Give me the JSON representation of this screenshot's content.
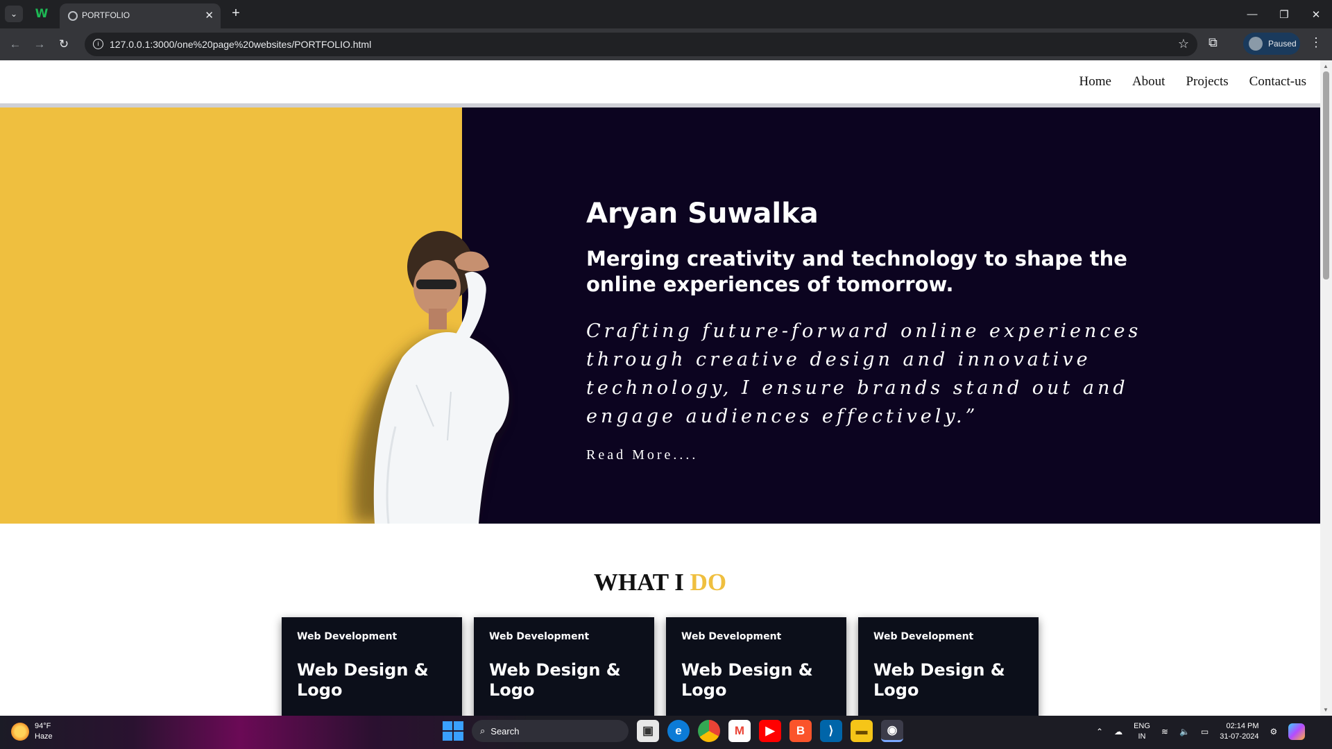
{
  "browser": {
    "tab_title": "PORTFOLIO",
    "url": "127.0.0.1:3000/one%20page%20websites/PORTFOLIO.html",
    "profile_label": "Paused",
    "pinned_tab_letter": "W"
  },
  "site": {
    "nav": [
      "Home",
      "About",
      "Projects",
      "Contact-us"
    ],
    "hero": {
      "name": "Aryan Suwalka",
      "tagline": "Merging creativity and technology to shape the online experiences of tomorrow.",
      "quote": "Crafting future-forward online experiences through creative design and innovative technology, I ensure brands stand out and engage audiences effectively.”",
      "read_more": "Read More...."
    },
    "section": {
      "title_main": "WHAT I",
      "title_accent": "DO"
    },
    "cards": [
      {
        "category": "Web Development",
        "title": "Web Design & Logo"
      },
      {
        "category": "Web Development",
        "title": "Web Design & Logo"
      },
      {
        "category": "Web Development",
        "title": "Web Design & Logo"
      },
      {
        "category": "Web Development",
        "title": "Web Design & Logo"
      }
    ],
    "colors": {
      "accent": "#efbf3f",
      "hero_dark": "#0c0420",
      "card_bg": "#0c0f1a"
    }
  },
  "taskbar": {
    "weather_temp": "94°F",
    "weather_desc": "Haze",
    "search_label": "Search",
    "lang_line1": "ENG",
    "lang_line2": "IN",
    "time": "02:14 PM",
    "date": "31-07-2024"
  }
}
